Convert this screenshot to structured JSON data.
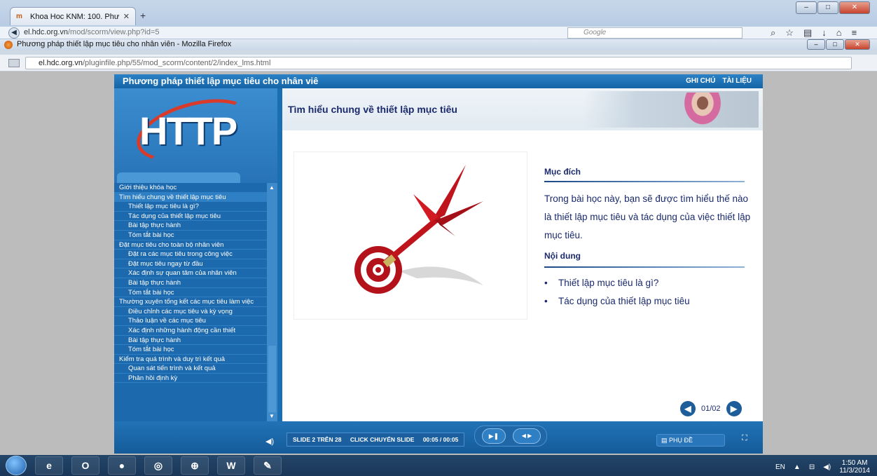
{
  "browser": {
    "tab_title": "Khoa Hoc KNM: 100. Phươ...",
    "url_host": "el.hdc.org.vn",
    "url_path": "/mod/scorm/view.php?id=5",
    "search_placeholder": "Google",
    "popup_title": "Phương pháp thiết lập mục tiêu cho nhân viên - Mozilla Firefox",
    "popup_url_host": "el.hdc.org.vn",
    "popup_url_path": "/pluginfile.php/55/mod_scorm/content/2/index_lms.html"
  },
  "player": {
    "course_title": "Phương pháp thiết lập mục tiêu cho nhân viê",
    "link_notes": "GHI CHÚ",
    "link_docs": "TÀI LIỆU",
    "logo_text": "HTTP"
  },
  "menu": [
    {
      "label": "Giới thiệu khóa học",
      "sub": false,
      "active": false
    },
    {
      "label": "Tìm hiểu chung về thiết lập mục tiêu",
      "sub": false,
      "active": true
    },
    {
      "label": "Thiết lập mục tiêu là gì?",
      "sub": true,
      "active": false
    },
    {
      "label": "Tác dụng của thiết lập mục tiêu",
      "sub": true,
      "active": false
    },
    {
      "label": "Bài tập thực hành",
      "sub": true,
      "active": false
    },
    {
      "label": "Tóm tắt bài học",
      "sub": true,
      "active": false
    },
    {
      "label": "Đặt mục tiêu cho toàn bộ nhân viên",
      "sub": false,
      "active": false
    },
    {
      "label": "Đặt ra các mục tiêu trong công việc",
      "sub": true,
      "active": false
    },
    {
      "label": "Đặt mục tiêu ngay từ đầu",
      "sub": true,
      "active": false
    },
    {
      "label": "Xác định sự quan tâm của nhân viên",
      "sub": true,
      "active": false
    },
    {
      "label": "Bài tập thực hành",
      "sub": true,
      "active": false
    },
    {
      "label": "Tóm tắt bài học",
      "sub": true,
      "active": false
    },
    {
      "label": "Thường xuyên tổng kết các mục tiêu làm việc",
      "sub": false,
      "active": false
    },
    {
      "label": "Điều chỉnh các mục tiêu và kỳ vọng",
      "sub": true,
      "active": false
    },
    {
      "label": "Thảo luận về các mục tiêu",
      "sub": true,
      "active": false
    },
    {
      "label": "Xác định những hành động cần thiết",
      "sub": true,
      "active": false
    },
    {
      "label": "Bài tập thực hành",
      "sub": true,
      "active": false
    },
    {
      "label": "Tóm tắt bài học",
      "sub": true,
      "active": false
    },
    {
      "label": "Kiểm tra quá trình và duy trì kết quả",
      "sub": false,
      "active": false
    },
    {
      "label": "Quan sát tiến trình và kết quả",
      "sub": true,
      "active": false
    },
    {
      "label": "Phản hồi định kỳ",
      "sub": true,
      "active": false
    }
  ],
  "slide": {
    "title": "Tìm hiểu chung về thiết lập mục tiêu",
    "purpose_heading": "Mục đích",
    "purpose_text": "Trong bài học này, bạn sẽ được tìm hiểu thế nào là thiết lập mục tiêu và tác dụng của việc thiết lập mục tiêu.",
    "content_heading": "Nội dung",
    "bullets": [
      "Thiết lập mục tiêu là gì?",
      "Tác dụng của thiết lập mục tiêu"
    ],
    "page_indicator": "01/02"
  },
  "controls": {
    "slide_counter": "SLIDE 2 TRÊN 28",
    "click_label": "CLICK CHUYỂN SLIDE",
    "time": "00:05 / 00:05",
    "subtitle_btn": "PHỤ ĐỀ"
  },
  "taskbar": {
    "lang": "EN",
    "time": "1:50 AM",
    "date": "11/3/2014"
  }
}
